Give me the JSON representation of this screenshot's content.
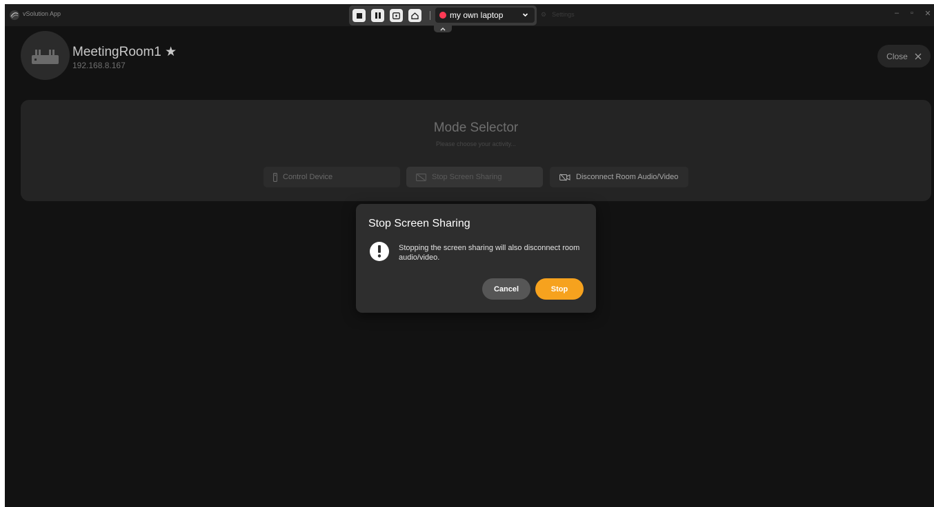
{
  "window": {
    "app_title": "vSolution App",
    "settings_label": "Settings"
  },
  "recording_toolbar": {
    "source_selected": "my own laptop",
    "record_color": "#ff3a55"
  },
  "device": {
    "name": "MeetingRoom1 ★",
    "ip": "192.168.8.167",
    "close_label": "Close"
  },
  "mode_selector": {
    "title": "Mode Selector",
    "subtitle": "Please choose your activity...",
    "buttons": [
      {
        "label": "Control Device",
        "icon": "remote-control-icon"
      },
      {
        "label": "Stop Screen Sharing",
        "icon": "screen-share-off-icon"
      },
      {
        "label": "Disconnect Room Audio/Video",
        "icon": "video-off-icon"
      }
    ]
  },
  "dialog": {
    "title": "Stop Screen Sharing",
    "message": "Stopping the screen sharing will also disconnect room audio/video.",
    "cancel_label": "Cancel",
    "stop_label": "Stop",
    "accent_color": "#f6a21e"
  }
}
